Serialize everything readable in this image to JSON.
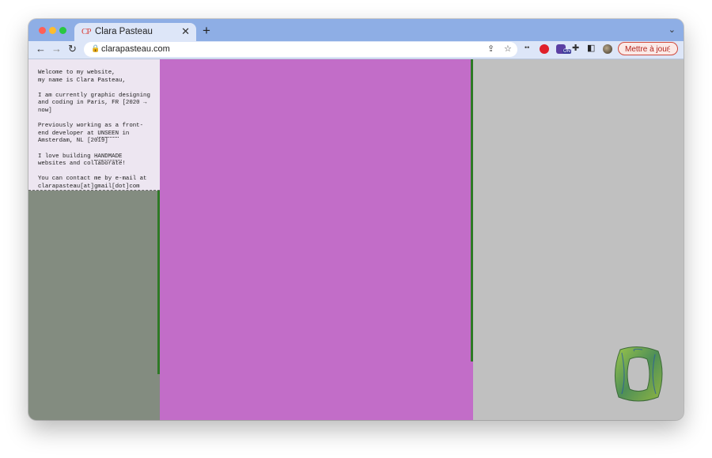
{
  "browser": {
    "tab_title": "Clara Pasteau",
    "tab_favicon": "CP",
    "url": "clarapasteau.com",
    "update_button": "Mettre à jour",
    "icons": {
      "back": "←",
      "forward": "→",
      "reload": "↻",
      "lock": "🔒",
      "share": "⇪",
      "star": "☆",
      "more": "⋮",
      "chevron": "⌄",
      "close": "✕",
      "plus": "+",
      "puzzle": "✚",
      "panel": "◧",
      "dots": "••"
    },
    "extension_badge": "ON"
  },
  "page": {
    "bio": {
      "p1": "Welcome to my website,\nmy name is Clara Pasteau,",
      "p2": "I am currently graphic designing and coding in Paris, FR [2020 → now]",
      "p3_a": "Previously working as a front-end developer at ",
      "p3_link": "UNSEEN",
      "p3_b": " in Amsterdam, NL [2019]",
      "p4_a": "I love building ",
      "p4_link": "HANDMADE",
      "p4_b": " websites and collaborate!",
      "p5": "You can contact me by e-mail at clarapasteau[at]gmail[dot]com"
    },
    "colors": {
      "left_column": "#838c80",
      "middle_column": "#c26dc8",
      "right_column": "#c0c0c0",
      "divider": "#2d7a25",
      "bio_background": "#ede6f1"
    }
  }
}
